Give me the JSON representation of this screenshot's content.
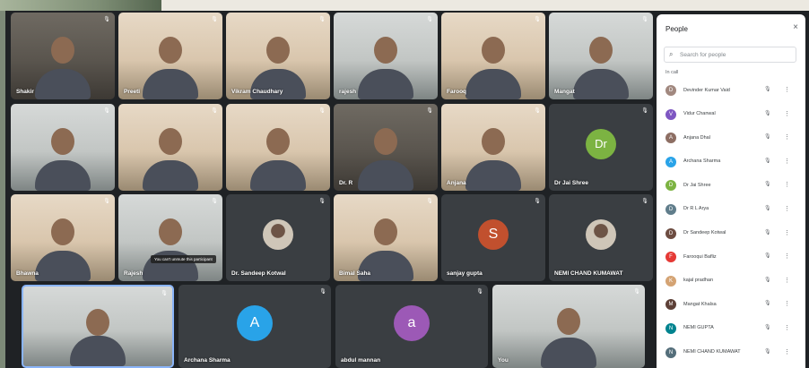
{
  "tiles": [
    {
      "name": "Shakir",
      "kind": "video",
      "tone": "dark"
    },
    {
      "name": "Preeti",
      "kind": "video",
      "tone": "warm"
    },
    {
      "name": "Vikram Chaudhary",
      "kind": "video",
      "tone": "warm"
    },
    {
      "name": "rajesh",
      "kind": "video",
      "tone": "cool"
    },
    {
      "name": "Farooq",
      "kind": "video",
      "tone": "warm"
    },
    {
      "name": "Mangat",
      "kind": "video",
      "tone": "cool"
    },
    {
      "name": "",
      "kind": "video",
      "tone": "cool"
    },
    {
      "name": "",
      "kind": "video",
      "tone": "warm"
    },
    {
      "name": "",
      "kind": "video",
      "tone": "warm"
    },
    {
      "name": "Dr. R",
      "kind": "video",
      "tone": "dark"
    },
    {
      "name": "Anjana",
      "kind": "video",
      "tone": "warm"
    },
    {
      "name": "Dr Jai Shree",
      "kind": "avatar",
      "letter": "Dr",
      "color": "#7cb342"
    },
    {
      "name": "Bhawna",
      "kind": "video",
      "tone": "warm"
    },
    {
      "name": "Rajesh",
      "kind": "video",
      "tone": "cool",
      "tooltip": "You can't unmute this participant"
    },
    {
      "name": "Dr. Sandeep Kotwal",
      "kind": "photo"
    },
    {
      "name": "Bimal Saha",
      "kind": "video",
      "tone": "warm"
    },
    {
      "name": "sanjay gupta",
      "kind": "avatar",
      "letter": "S",
      "color": "#c1502e"
    },
    {
      "name": "NEMI CHAND KUMAWAT",
      "kind": "photo"
    },
    {
      "name": "",
      "kind": "video",
      "tone": "cool"
    },
    {
      "name": "Archana Sharma",
      "kind": "avatar",
      "letter": "A",
      "color": "#29a3e8"
    },
    {
      "name": "abdul mannan",
      "kind": "avatar",
      "letter": "a",
      "color": "#9c59b6"
    },
    {
      "name": "You",
      "kind": "video",
      "tone": "cool"
    }
  ],
  "panel": {
    "title": "People",
    "close": "×",
    "search_icon": "⌕",
    "search_placeholder": "Search for people",
    "section": "In call",
    "mute_icon": "mic-off-icon",
    "more_icon": "more-vert-icon",
    "participants": [
      {
        "name": "Devinder Kumar Vaid",
        "initial": "D",
        "color": "#a1887f"
      },
      {
        "name": "Vidur Chanwal",
        "initial": "V",
        "color": "#7e57c2"
      },
      {
        "name": "Anjana Dhal",
        "initial": "A",
        "color": "#8d6e63"
      },
      {
        "name": "Archana Sharma",
        "initial": "A",
        "color": "#29a3e8"
      },
      {
        "name": "Dr Jai Shree",
        "initial": "D",
        "color": "#7cb342"
      },
      {
        "name": "Dr R L Arya",
        "initial": "D",
        "color": "#607d8b"
      },
      {
        "name": "Dr Sandeep Kotwal",
        "initial": "D",
        "color": "#6d4c41"
      },
      {
        "name": "Farooqui Bafliz",
        "initial": "F",
        "color": "#e53935"
      },
      {
        "name": "kajal pradhan",
        "initial": "K",
        "color": "#d4a373"
      },
      {
        "name": "Mangat Khalsa",
        "initial": "M",
        "color": "#5d4037"
      },
      {
        "name": "NEMI GUPTA",
        "initial": "N",
        "color": "#00838f"
      },
      {
        "name": "NEMI CHAND KUMAWAT",
        "initial": "N",
        "color": "#546e7a"
      }
    ]
  },
  "colors": {
    "screen_bg": "#1f2225",
    "tile_bg": "#3a3e42",
    "panel_bg": "#ffffff"
  }
}
